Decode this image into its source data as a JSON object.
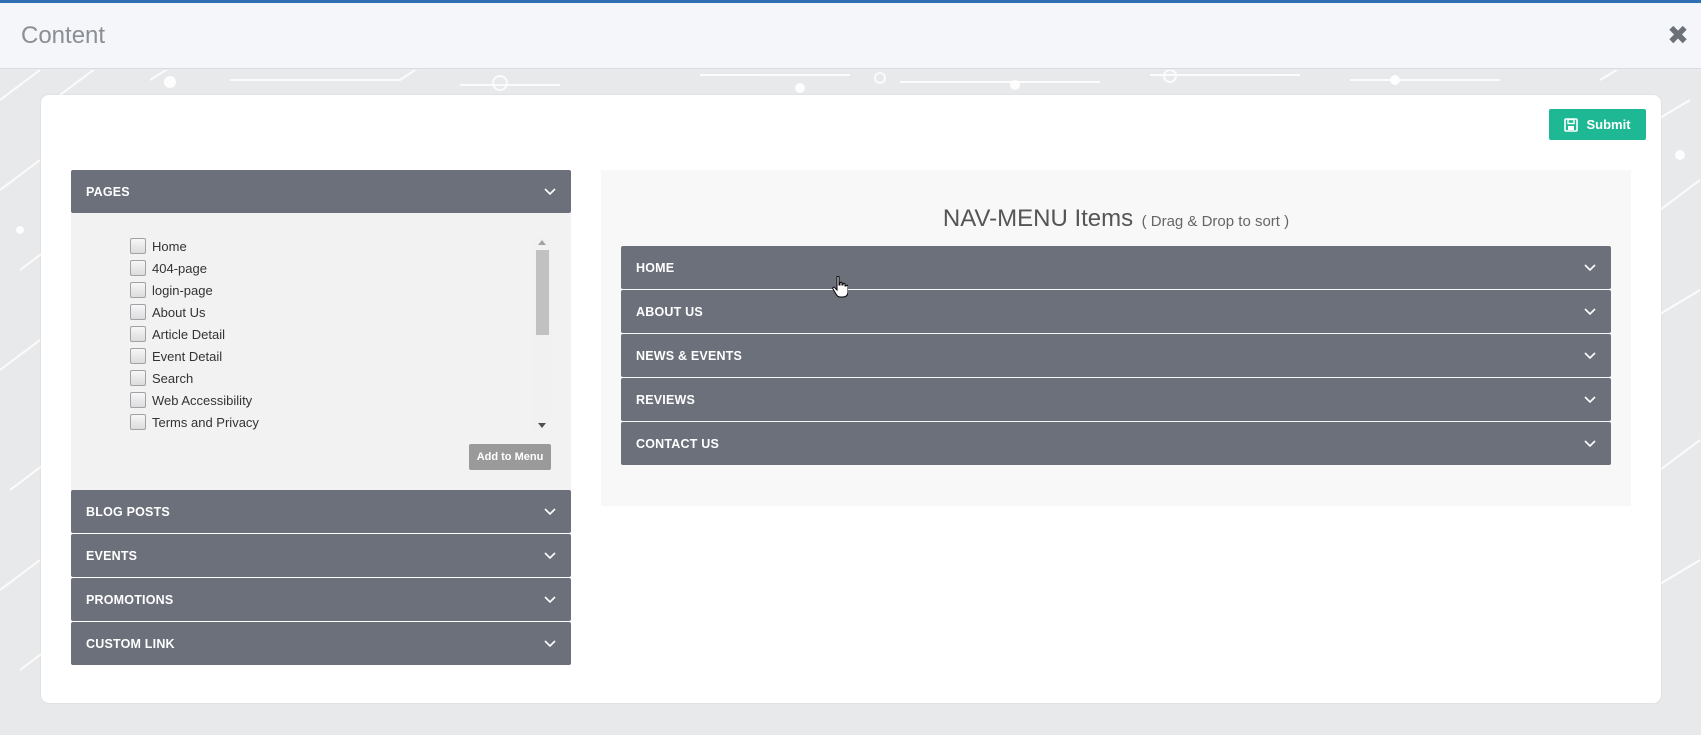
{
  "modal": {
    "title": "Content",
    "close_label": "✖"
  },
  "toolbar": {
    "submit_label": "Submit",
    "submit_icon": "save-icon"
  },
  "pages_panel": {
    "header": "PAGES",
    "items": [
      {
        "label": "Home",
        "checked": false
      },
      {
        "label": "404-page",
        "checked": false
      },
      {
        "label": "login-page",
        "checked": false
      },
      {
        "label": "About Us",
        "checked": false
      },
      {
        "label": "Article Detail",
        "checked": false
      },
      {
        "label": "Event Detail",
        "checked": false
      },
      {
        "label": "Search",
        "checked": false
      },
      {
        "label": "Web Accessibility",
        "checked": false
      },
      {
        "label": "Terms and Privacy",
        "checked": false
      }
    ],
    "add_button_label": "Add to Menu"
  },
  "other_panels": [
    {
      "label": "BLOG POSTS"
    },
    {
      "label": "EVENTS"
    },
    {
      "label": "PROMOTIONS"
    },
    {
      "label": "CUSTOM LINK"
    }
  ],
  "nav_menu": {
    "title": "NAV-MENU Items",
    "subtitle": "( Drag & Drop to sort )",
    "items": [
      {
        "label": "HOME"
      },
      {
        "label": "ABOUT US"
      },
      {
        "label": "NEWS & EVENTS"
      },
      {
        "label": "REVIEWS"
      },
      {
        "label": "CONTACT US"
      }
    ]
  },
  "colors": {
    "accordion_header": "#6b707b",
    "submit_button": "#1fb894",
    "add_button": "#9a9a9a",
    "top_bar": "#2f6fb3"
  }
}
